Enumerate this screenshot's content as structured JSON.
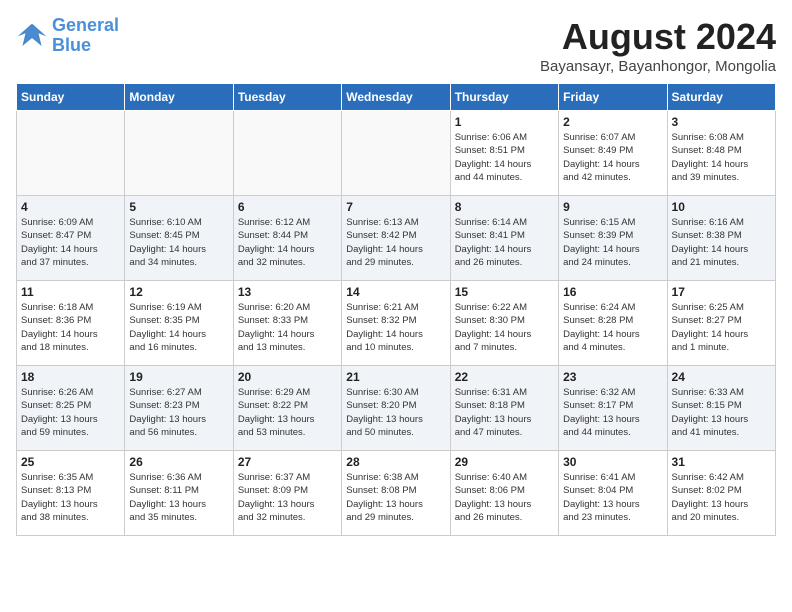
{
  "header": {
    "logo_line1": "General",
    "logo_line2": "Blue",
    "main_title": "August 2024",
    "subtitle": "Bayansayr, Bayanhongor, Mongolia"
  },
  "days_of_week": [
    "Sunday",
    "Monday",
    "Tuesday",
    "Wednesday",
    "Thursday",
    "Friday",
    "Saturday"
  ],
  "weeks": [
    [
      {
        "day": "",
        "info": ""
      },
      {
        "day": "",
        "info": ""
      },
      {
        "day": "",
        "info": ""
      },
      {
        "day": "",
        "info": ""
      },
      {
        "day": "1",
        "info": "Sunrise: 6:06 AM\nSunset: 8:51 PM\nDaylight: 14 hours\nand 44 minutes."
      },
      {
        "day": "2",
        "info": "Sunrise: 6:07 AM\nSunset: 8:49 PM\nDaylight: 14 hours\nand 42 minutes."
      },
      {
        "day": "3",
        "info": "Sunrise: 6:08 AM\nSunset: 8:48 PM\nDaylight: 14 hours\nand 39 minutes."
      }
    ],
    [
      {
        "day": "4",
        "info": "Sunrise: 6:09 AM\nSunset: 8:47 PM\nDaylight: 14 hours\nand 37 minutes."
      },
      {
        "day": "5",
        "info": "Sunrise: 6:10 AM\nSunset: 8:45 PM\nDaylight: 14 hours\nand 34 minutes."
      },
      {
        "day": "6",
        "info": "Sunrise: 6:12 AM\nSunset: 8:44 PM\nDaylight: 14 hours\nand 32 minutes."
      },
      {
        "day": "7",
        "info": "Sunrise: 6:13 AM\nSunset: 8:42 PM\nDaylight: 14 hours\nand 29 minutes."
      },
      {
        "day": "8",
        "info": "Sunrise: 6:14 AM\nSunset: 8:41 PM\nDaylight: 14 hours\nand 26 minutes."
      },
      {
        "day": "9",
        "info": "Sunrise: 6:15 AM\nSunset: 8:39 PM\nDaylight: 14 hours\nand 24 minutes."
      },
      {
        "day": "10",
        "info": "Sunrise: 6:16 AM\nSunset: 8:38 PM\nDaylight: 14 hours\nand 21 minutes."
      }
    ],
    [
      {
        "day": "11",
        "info": "Sunrise: 6:18 AM\nSunset: 8:36 PM\nDaylight: 14 hours\nand 18 minutes."
      },
      {
        "day": "12",
        "info": "Sunrise: 6:19 AM\nSunset: 8:35 PM\nDaylight: 14 hours\nand 16 minutes."
      },
      {
        "day": "13",
        "info": "Sunrise: 6:20 AM\nSunset: 8:33 PM\nDaylight: 14 hours\nand 13 minutes."
      },
      {
        "day": "14",
        "info": "Sunrise: 6:21 AM\nSunset: 8:32 PM\nDaylight: 14 hours\nand 10 minutes."
      },
      {
        "day": "15",
        "info": "Sunrise: 6:22 AM\nSunset: 8:30 PM\nDaylight: 14 hours\nand 7 minutes."
      },
      {
        "day": "16",
        "info": "Sunrise: 6:24 AM\nSunset: 8:28 PM\nDaylight: 14 hours\nand 4 minutes."
      },
      {
        "day": "17",
        "info": "Sunrise: 6:25 AM\nSunset: 8:27 PM\nDaylight: 14 hours\nand 1 minute."
      }
    ],
    [
      {
        "day": "18",
        "info": "Sunrise: 6:26 AM\nSunset: 8:25 PM\nDaylight: 13 hours\nand 59 minutes."
      },
      {
        "day": "19",
        "info": "Sunrise: 6:27 AM\nSunset: 8:23 PM\nDaylight: 13 hours\nand 56 minutes."
      },
      {
        "day": "20",
        "info": "Sunrise: 6:29 AM\nSunset: 8:22 PM\nDaylight: 13 hours\nand 53 minutes."
      },
      {
        "day": "21",
        "info": "Sunrise: 6:30 AM\nSunset: 8:20 PM\nDaylight: 13 hours\nand 50 minutes."
      },
      {
        "day": "22",
        "info": "Sunrise: 6:31 AM\nSunset: 8:18 PM\nDaylight: 13 hours\nand 47 minutes."
      },
      {
        "day": "23",
        "info": "Sunrise: 6:32 AM\nSunset: 8:17 PM\nDaylight: 13 hours\nand 44 minutes."
      },
      {
        "day": "24",
        "info": "Sunrise: 6:33 AM\nSunset: 8:15 PM\nDaylight: 13 hours\nand 41 minutes."
      }
    ],
    [
      {
        "day": "25",
        "info": "Sunrise: 6:35 AM\nSunset: 8:13 PM\nDaylight: 13 hours\nand 38 minutes."
      },
      {
        "day": "26",
        "info": "Sunrise: 6:36 AM\nSunset: 8:11 PM\nDaylight: 13 hours\nand 35 minutes."
      },
      {
        "day": "27",
        "info": "Sunrise: 6:37 AM\nSunset: 8:09 PM\nDaylight: 13 hours\nand 32 minutes."
      },
      {
        "day": "28",
        "info": "Sunrise: 6:38 AM\nSunset: 8:08 PM\nDaylight: 13 hours\nand 29 minutes."
      },
      {
        "day": "29",
        "info": "Sunrise: 6:40 AM\nSunset: 8:06 PM\nDaylight: 13 hours\nand 26 minutes."
      },
      {
        "day": "30",
        "info": "Sunrise: 6:41 AM\nSunset: 8:04 PM\nDaylight: 13 hours\nand 23 minutes."
      },
      {
        "day": "31",
        "info": "Sunrise: 6:42 AM\nSunset: 8:02 PM\nDaylight: 13 hours\nand 20 minutes."
      }
    ]
  ]
}
